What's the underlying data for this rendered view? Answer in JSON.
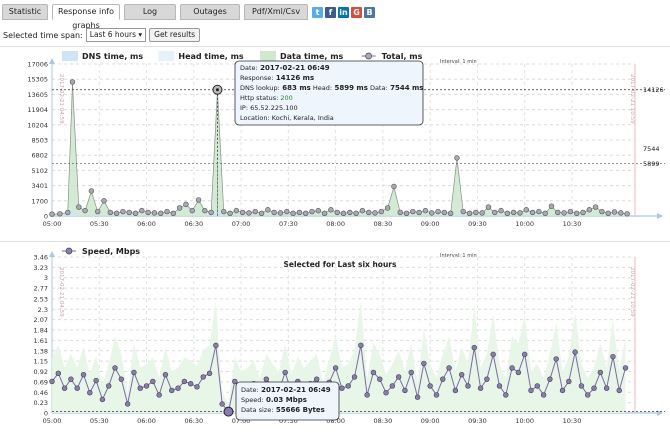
{
  "tabs": [
    "Statistic",
    "Response info graphs",
    "Log",
    "Outages",
    "Pdf/Xml/Csv"
  ],
  "active_tab": 1,
  "social_icons": [
    {
      "name": "twitter-icon",
      "glyph": "t",
      "color": "#55acee"
    },
    {
      "name": "facebook-icon",
      "glyph": "f",
      "color": "#3b5998"
    },
    {
      "name": "linkedin-icon",
      "glyph": "in",
      "color": "#0077b5"
    },
    {
      "name": "google-plus-icon",
      "glyph": "G",
      "color": "#dd4b39"
    },
    {
      "name": "vk-icon",
      "glyph": "B",
      "color": "#4a76a8"
    }
  ],
  "controls": {
    "time_span_label": "Selected time span:",
    "time_span_value": "Last 6 hours",
    "get_results_label": "Get results"
  },
  "chart_data": [
    {
      "type": "area",
      "title": "Selected for Last six hours",
      "interval_label": "Interval: 1 min",
      "legend": [
        "DNS time, ms",
        "Head time, ms",
        "Data time, ms",
        "Total, ms"
      ],
      "legend_placement": "top-left",
      "y_ticks": [
        0,
        1700,
        3401,
        5102,
        6802,
        8503,
        10204,
        11904,
        13605,
        15305,
        17006
      ],
      "ylim": [
        0,
        17006
      ],
      "x_ticks": [
        "05:00",
        "05:30",
        "06:00",
        "06:30",
        "07:00",
        "07:30",
        "08:00",
        "08:30",
        "09:00",
        "09:30",
        "10:00",
        "10:30"
      ],
      "xlim_minutes": [
        0,
        370
      ],
      "start_date_label": "2017-02-21 04:59",
      "end_date_label": "2017-02-21 10:59",
      "right_labels": [
        "14126",
        "7544",
        "5899"
      ],
      "series": [
        {
          "name": "Total, ms",
          "x": [
            0,
            5,
            10,
            13,
            17,
            21,
            25,
            29,
            33,
            37,
            41,
            45,
            49,
            53,
            57,
            61,
            65,
            69,
            73,
            77,
            81,
            85,
            89,
            93,
            97,
            101,
            105,
            109,
            113,
            117,
            121,
            125,
            129,
            133,
            137,
            141,
            145,
            149,
            153,
            157,
            161,
            165,
            169,
            173,
            177,
            181,
            185,
            189,
            193,
            197,
            201,
            205,
            209,
            213,
            217,
            221,
            225,
            229,
            233,
            237,
            241,
            245,
            249,
            253,
            257,
            261,
            265,
            269,
            273,
            277,
            281,
            285,
            289,
            293,
            297,
            301,
            305,
            309,
            313,
            317,
            321,
            325,
            329,
            333,
            337,
            341,
            345,
            349,
            353,
            357,
            361,
            365
          ],
          "values": [
            200,
            250,
            400,
            15000,
            1000,
            600,
            2800,
            500,
            1700,
            400,
            300,
            500,
            400,
            300,
            600,
            400,
            350,
            300,
            500,
            300,
            900,
            1300,
            600,
            1800,
            600,
            400,
            14126,
            500,
            300,
            600,
            400,
            350,
            500,
            300,
            700,
            400,
            350,
            500,
            300,
            400,
            300,
            500,
            600,
            300,
            700,
            400,
            300,
            400,
            300,
            600,
            400,
            350,
            500,
            900,
            3300,
            400,
            300,
            500,
            400,
            600,
            350,
            500,
            400,
            300,
            6500,
            500,
            300,
            400,
            350,
            1000,
            400,
            600,
            300,
            400,
            350,
            700,
            400,
            500,
            300,
            1100,
            400,
            350,
            500,
            300,
            400,
            700,
            1000,
            500,
            300,
            450,
            350,
            250
          ]
        }
      ]
    },
    {
      "type": "line",
      "title": "Selected for Last six hours",
      "interval_label": "Interval: 1 min",
      "legend": [
        "Speed, Mbps"
      ],
      "legend_placement": "top-left",
      "y_ticks": [
        0,
        0.23,
        0.46,
        0.69,
        0.92,
        1.15,
        1.38,
        1.61,
        1.84,
        2.07,
        2.3,
        2.53,
        2.77,
        3.0,
        3.23,
        3.46
      ],
      "ylim": [
        0,
        3.46
      ],
      "x_ticks": [
        "05:00",
        "05:30",
        "06:00",
        "06:30",
        "07:00",
        "07:30",
        "08:00",
        "08:30",
        "09:00",
        "09:30",
        "10:00",
        "10:30"
      ],
      "xlim_minutes": [
        0,
        370
      ],
      "start_date_label": "2017-02-21 04:59",
      "end_date_label": "2017-02-21 10:59",
      "series": [
        {
          "name": "Speed, Mbps",
          "x": [
            0,
            4,
            8,
            12,
            16,
            20,
            24,
            28,
            32,
            36,
            40,
            44,
            48,
            52,
            56,
            60,
            64,
            68,
            72,
            76,
            80,
            84,
            88,
            92,
            96,
            100,
            104,
            108,
            112,
            116,
            120,
            124,
            128,
            132,
            136,
            140,
            144,
            148,
            152,
            156,
            160,
            164,
            168,
            172,
            176,
            180,
            184,
            188,
            192,
            196,
            200,
            204,
            208,
            212,
            216,
            220,
            224,
            228,
            232,
            236,
            240,
            244,
            248,
            252,
            256,
            260,
            264,
            268,
            272,
            276,
            280,
            284,
            288,
            292,
            296,
            300,
            304,
            308,
            312,
            316,
            320,
            324,
            328,
            332,
            336,
            340,
            344,
            348,
            352,
            356,
            360,
            364
          ],
          "values": [
            0.7,
            0.88,
            0.55,
            0.75,
            0.55,
            0.85,
            0.45,
            0.72,
            0.3,
            0.6,
            1.0,
            0.75,
            0.2,
            0.9,
            0.55,
            0.6,
            0.7,
            0.4,
            0.85,
            0.5,
            0.55,
            0.7,
            0.65,
            0.58,
            0.8,
            0.88,
            1.5,
            0.2,
            0.03,
            0.7,
            0.5,
            0.55,
            0.65,
            0.4,
            0.75,
            0.6,
            0.5,
            0.9,
            0.45,
            0.7,
            0.55,
            0.65,
            0.75,
            0.35,
            0.68,
            1.0,
            0.55,
            0.6,
            0.8,
            1.5,
            0.4,
            0.9,
            0.75,
            0.45,
            0.6,
            0.8,
            0.5,
            0.9,
            0.35,
            1.1,
            0.6,
            0.4,
            0.75,
            1.0,
            0.5,
            0.85,
            0.6,
            1.45,
            0.55,
            0.75,
            1.3,
            0.6,
            0.4,
            1.0,
            0.9,
            1.3,
            0.5,
            0.6,
            0.4,
            0.75,
            1.2,
            0.5,
            0.7,
            1.35,
            0.6,
            0.4,
            0.55,
            0.9,
            0.55,
            1.25,
            0.5,
            1.0
          ]
        }
      ]
    }
  ],
  "tooltip_top": {
    "date_label": "Date:",
    "date_value": "2017-02-21 06:49",
    "response_label": "Response:",
    "response_value": "14126 ms",
    "dns_label": "DNS lookup:",
    "dns_value": "683 ms",
    "head_label": "Head:",
    "head_value": "5899 ms",
    "data_label": "Data:",
    "data_value": "7544 ms",
    "http_label": "Http status:",
    "http_value": "200",
    "ip_label": "IP:",
    "ip_value": "65.52.225.100",
    "location_label": "Location:",
    "location_value": "Kochi, Kerala, India"
  },
  "tooltip_bottom": {
    "date_label": "Date:",
    "date_value": "2017-02-21 06:49",
    "speed_label": "Speed:",
    "speed_value": "0.03 Mbps",
    "size_label": "Data size:",
    "size_value": "55666 Bytes"
  },
  "colors": {
    "area_fill": "#cfe9cf",
    "area_stroke": "#a8d8a8",
    "dns_fill": "#cfe4f5",
    "line_stroke": "#7a6aa8",
    "marker_fill": "#a8a8b8",
    "speed_marker": "#8a7ab8",
    "right_axis": "#f4b8b8",
    "bottom_axis": "#a8c8e8"
  }
}
